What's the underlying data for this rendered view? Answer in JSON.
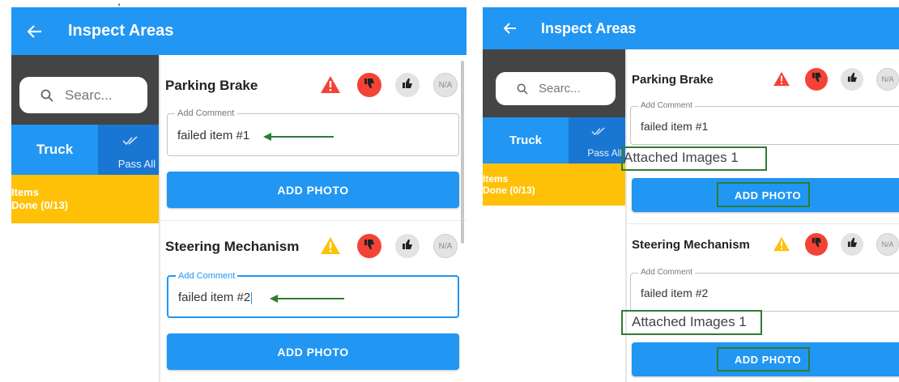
{
  "screens": [
    {
      "header": {
        "back_icon": "arrow-left-icon",
        "title": "Inspect Areas"
      },
      "search": {
        "placeholder": "Searc...",
        "icon": "search-icon"
      },
      "tabs": {
        "truck_label": "Truck",
        "pass_all_label": "Pass All",
        "pass_all_icon": "double-check-icon"
      },
      "items_status": {
        "label": "Items",
        "done": "Done (0/13)"
      },
      "inspection_items": [
        {
          "title": "Parking Brake",
          "warning_color": "#f44336",
          "comment_label": "Add Comment",
          "comment_value": "failed item #1",
          "button_label": "ADD PHOTO",
          "na_label": "N/A"
        },
        {
          "title": "Steering Mechanism",
          "warning_color": "#ffc107",
          "comment_label": "Add Comment",
          "comment_value": "failed item #2",
          "button_label": "ADD PHOTO",
          "na_label": "N/A"
        }
      ]
    },
    {
      "header": {
        "back_icon": "arrow-left-icon",
        "title": "Inspect Areas"
      },
      "search": {
        "placeholder": "Searc...",
        "icon": "search-icon"
      },
      "tabs": {
        "truck_label": "Truck",
        "pass_all_label": "Pass All",
        "pass_all_icon": "double-check-icon"
      },
      "items_status": {
        "label": "Items",
        "done": "Done (0/13)"
      },
      "inspection_items": [
        {
          "title": "Parking Brake",
          "warning_color": "#f44336",
          "comment_label": "Add Comment",
          "comment_value": "failed item #1",
          "attached_images": "Attached Images 1",
          "button_label": "ADD PHOTO",
          "na_label": "N/A"
        },
        {
          "title": "Steering Mechanism",
          "warning_color": "#ffc107",
          "comment_label": "Add Comment",
          "comment_value": "failed item #2",
          "attached_images": "Attached Images 1",
          "button_label": "ADD PHOTO",
          "na_label": "N/A"
        }
      ]
    }
  ],
  "colors": {
    "primary": "#2196f3",
    "thumbs_down": "#f44336",
    "items_panel": "#ffc107",
    "annotation": "#2e7d32"
  }
}
